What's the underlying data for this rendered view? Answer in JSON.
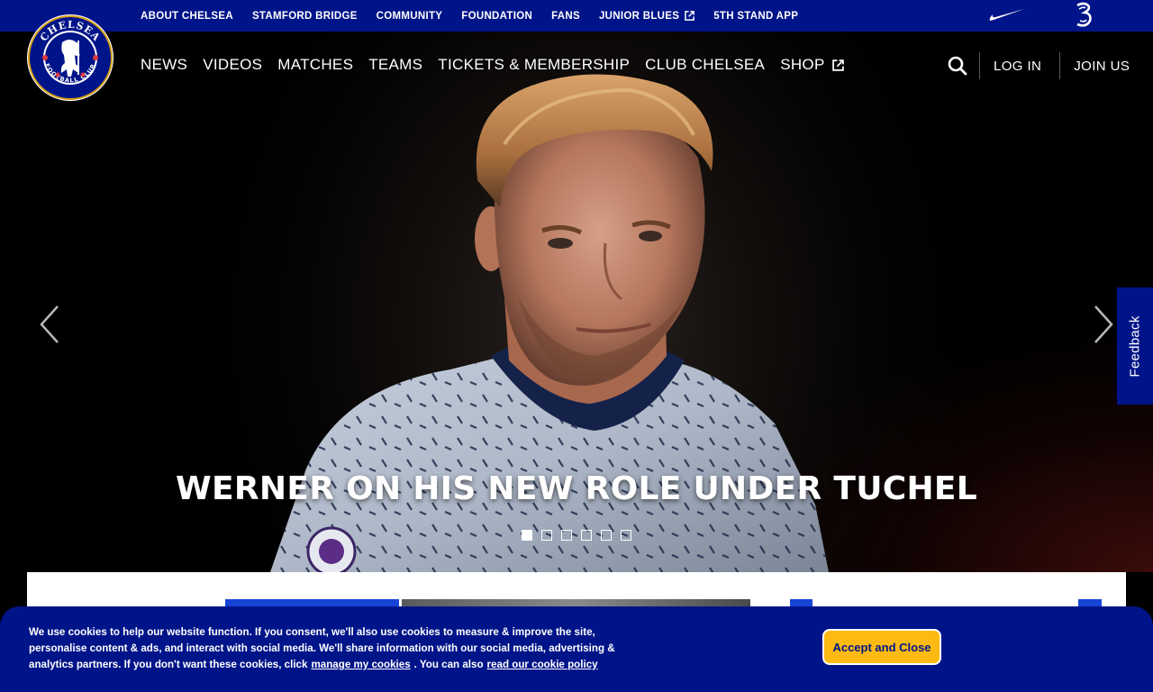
{
  "top_bar": {
    "links": [
      {
        "label": "ABOUT CHELSEA",
        "external": false
      },
      {
        "label": "STAMFORD BRIDGE",
        "external": false
      },
      {
        "label": "COMMUNITY",
        "external": false
      },
      {
        "label": "FOUNDATION",
        "external": false
      },
      {
        "label": "FANS",
        "external": false
      },
      {
        "label": "JUNIOR BLUES",
        "external": true
      },
      {
        "label": "5TH STAND APP",
        "external": false
      }
    ],
    "sponsors": [
      "nike-logo",
      "three-logo"
    ]
  },
  "crest": {
    "text_top": "CHELSEA",
    "text_bottom": "FOOTBALL CLUB"
  },
  "main_nav": {
    "items": [
      {
        "label": "NEWS",
        "external": false
      },
      {
        "label": "VIDEOS",
        "external": false
      },
      {
        "label": "MATCHES",
        "external": false
      },
      {
        "label": "TEAMS",
        "external": false
      },
      {
        "label": "TICKETS & MEMBERSHIP",
        "external": false
      },
      {
        "label": "CLUB CHELSEA",
        "external": false
      },
      {
        "label": "SHOP",
        "external": true
      }
    ],
    "login_label": "LOG IN",
    "join_label": "JOIN US",
    "search_icon": "search-icon"
  },
  "hero": {
    "headline": "WERNER ON HIS NEW ROLE UNDER TUCHEL",
    "slide_count": 6,
    "active_slide": 1
  },
  "feedback": {
    "label": "Feedback"
  },
  "cookie_banner": {
    "text_1": "We use cookies to help our website function. If you consent, we'll also use cookies to measure & improve the site, personalise content & ads, and interact with social media. We'll share information with our social media, advertising & analytics partners. If you don't want these cookies, click",
    "manage_link": "manage my cookies",
    "text_2": ". You can also",
    "policy_link": "read our cookie policy",
    "accept_label": "Accept and Close"
  },
  "colors": {
    "brand_blue": "#001489",
    "accept_yellow": "#fdba12",
    "card_blue": "#1645d6"
  }
}
